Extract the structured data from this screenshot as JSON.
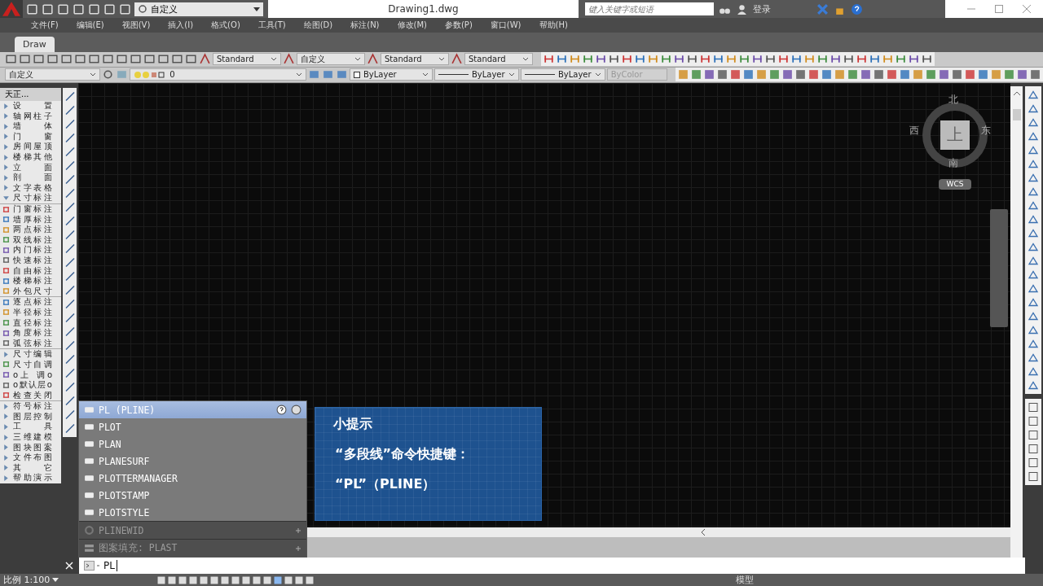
{
  "title_bar": {
    "workspace": "自定义",
    "title": "Drawing1.dwg",
    "search": {
      "placeholder": "键入关键字或短语"
    },
    "sign_in": "登录"
  },
  "menu_bar": [
    "文件(F)",
    "编辑(E)",
    "视图(V)",
    "插入(I)",
    "格式(O)",
    "工具(T)",
    "绘图(D)",
    "标注(N)",
    "修改(M)",
    "参数(P)",
    "窗口(W)",
    "帮助(H)"
  ],
  "file_tabs": [
    {
      "label": "Draw",
      "selected": true
    }
  ],
  "styles_toolbar": [
    "Standard",
    "自定义",
    "Standard",
    "Standard"
  ],
  "properties_toolbar": {
    "workspace": "自定义",
    "layer": "0",
    "color_control": "ByLayer",
    "linetype": "ByLayer",
    "lineweight": "ByLayer",
    "plot_style": {
      "value": "ByColor",
      "disabled": true
    }
  },
  "tianzheng_panel": {
    "title": "天正...",
    "items": [
      {
        "label": "设 置",
        "expanded": false
      },
      {
        "label": "轴网柱子",
        "expanded": false
      },
      {
        "label": "墙 体",
        "expanded": false
      },
      {
        "label": "门 窗",
        "expanded": false
      },
      {
        "label": "房间屋顶",
        "expanded": false
      },
      {
        "label": "楼梯其他",
        "expanded": false
      },
      {
        "label": "立 面",
        "expanded": false
      },
      {
        "label": "剖 面",
        "expanded": false
      },
      {
        "label": "文字表格",
        "expanded": false
      },
      {
        "label": "尺寸标注",
        "expanded": true,
        "children": [
          [
            {
              "label": "门窗标注",
              "kind": "tool"
            },
            {
              "label": "墙厚标注",
              "kind": "tool"
            },
            {
              "label": "两点标注",
              "kind": "tool"
            },
            {
              "label": "双线标注",
              "kind": "tool"
            },
            {
              "label": "内门标注",
              "kind": "tool"
            },
            {
              "label": "快速标注",
              "kind": "tool"
            },
            {
              "label": "自由标注",
              "kind": "tool"
            },
            {
              "label": "楼梯标注",
              "kind": "tool"
            },
            {
              "label": "外包尺寸",
              "kind": "tool"
            }
          ],
          [
            {
              "label": "逐点标注",
              "kind": "tool"
            },
            {
              "label": "半径标注",
              "kind": "tool"
            },
            {
              "label": "直径标注",
              "kind": "tool"
            },
            {
              "label": "角度标注",
              "kind": "tool"
            },
            {
              "label": "弧弦标注",
              "kind": "tool"
            }
          ],
          [
            {
              "label": "尺寸编辑",
              "kind": "menu"
            },
            {
              "label": "尺寸自调",
              "kind": "tool"
            },
            {
              "label": "o上 调o",
              "kind": "tool"
            },
            {
              "label": "o默认层o",
              "kind": "tool"
            },
            {
              "label": "检查关闭",
              "kind": "tool"
            }
          ]
        ]
      },
      {
        "label": "符号标注",
        "expanded": false
      },
      {
        "label": "图层控制",
        "expanded": false
      },
      {
        "label": "工 具",
        "expanded": false
      },
      {
        "label": "三维建模",
        "expanded": false
      },
      {
        "label": "图块图案",
        "expanded": false
      },
      {
        "label": "文件布图",
        "expanded": false
      },
      {
        "label": "其 它",
        "expanded": false
      },
      {
        "label": "帮助演示",
        "expanded": false
      }
    ]
  },
  "viewcube": {
    "north": "北",
    "south": "南",
    "east": "东",
    "west": "西",
    "top": "上",
    "ucs": "WCS"
  },
  "autocomplete": [
    {
      "label": "PL (PLINE)",
      "kind": "command",
      "selected": true
    },
    {
      "label": "PLOT",
      "kind": "command",
      "selected": false
    },
    {
      "label": "PLAN",
      "kind": "command",
      "selected": false
    },
    {
      "label": "PLANESURF",
      "kind": "command",
      "selected": false
    },
    {
      "label": "PLOTTERMANAGER",
      "kind": "command",
      "selected": false
    },
    {
      "label": "PLOTSTAMP",
      "kind": "command",
      "selected": false
    },
    {
      "label": "PLOTSTYLE",
      "kind": "command",
      "selected": false
    },
    {
      "label": "PLINEWID",
      "kind": "variable",
      "selected": false
    },
    {
      "label": "图案填充: PLAST",
      "kind": "hatch",
      "selected": false
    }
  ],
  "tip": {
    "title": "小提示",
    "lines": [
      "“多段线”命令快捷键：",
      "“PL”（PLINE）"
    ]
  },
  "command_line": {
    "value": "PL"
  },
  "status_bar": {
    "scale": "比例 1:100",
    "space": "模型"
  }
}
